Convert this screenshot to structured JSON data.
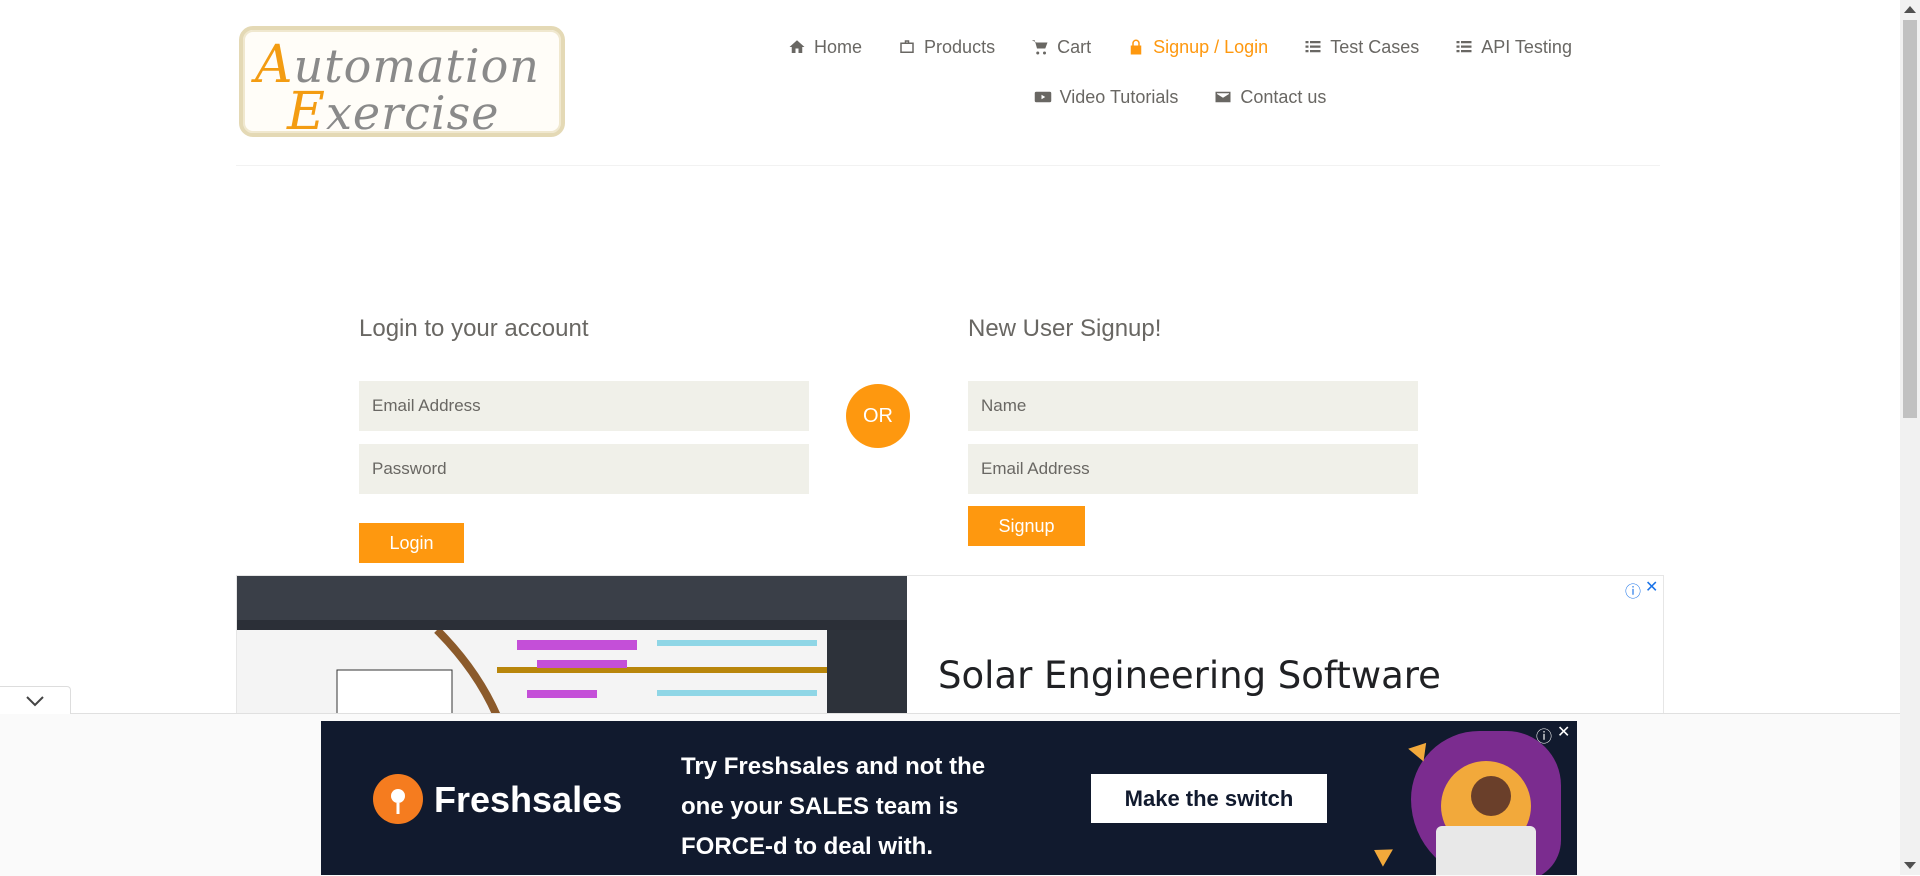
{
  "logo": {
    "line1_cap": "A",
    "line1_rest": "utomation",
    "line2_cap": "E",
    "line2_rest": "xercise"
  },
  "nav": [
    {
      "label": "Home",
      "icon": "home-icon",
      "active": false
    },
    {
      "label": "Products",
      "icon": "briefcase-icon",
      "active": false
    },
    {
      "label": "Cart",
      "icon": "cart-icon",
      "active": false
    },
    {
      "label": "Signup / Login",
      "icon": "lock-icon",
      "active": true
    },
    {
      "label": "Test Cases",
      "icon": "list-icon",
      "active": false
    },
    {
      "label": "API Testing",
      "icon": "list-icon",
      "active": false
    },
    {
      "label": "Video Tutorials",
      "icon": "youtube-icon",
      "active": false
    },
    {
      "label": "Contact us",
      "icon": "envelope-icon",
      "active": false
    }
  ],
  "login": {
    "title": "Login to your account",
    "email_placeholder": "Email Address",
    "password_placeholder": "Password",
    "button": "Login"
  },
  "or_label": "OR",
  "signup": {
    "title": "New User Signup!",
    "name_placeholder": "Name",
    "email_placeholder": "Email Address",
    "button": "Signup"
  },
  "ad_top": {
    "headline": "Solar Engineering Software",
    "info_icon": "info-icon",
    "close_icon": "close-icon"
  },
  "ad_bottom": {
    "brand": "Freshsales",
    "copy": "Try Freshsales and not the\none your SALES team is\nFORCE-d to deal with.",
    "cta": "Make the switch"
  },
  "colors": {
    "accent": "#fe980f",
    "text": "#696763",
    "input_bg": "#f0f0e9",
    "ad_dark": "#111a2e"
  }
}
